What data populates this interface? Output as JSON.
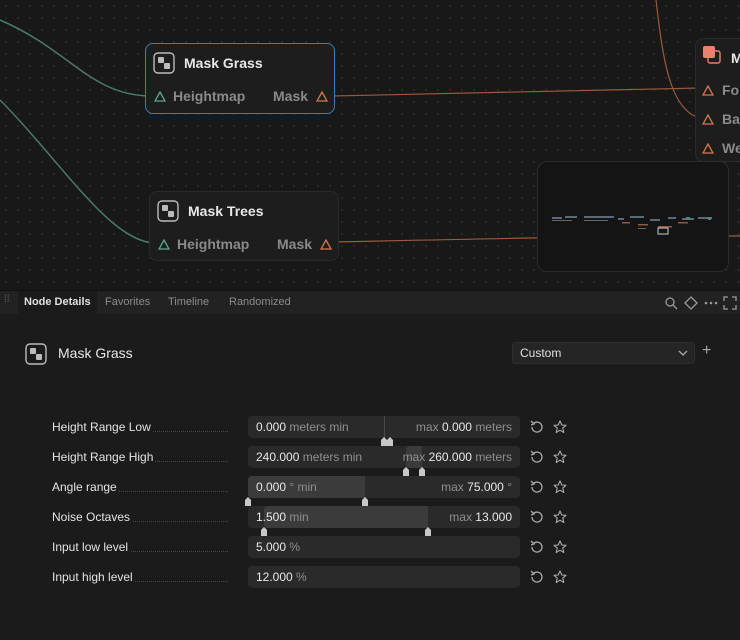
{
  "graph": {
    "nodes": [
      {
        "title": "Mask Grass",
        "input_label": "Heightmap",
        "output_label": "Mask",
        "selected": true
      },
      {
        "title": "Mask Trees",
        "input_label": "Heightmap",
        "output_label": "Mask",
        "selected": false
      },
      {
        "title": "M",
        "ports": [
          "For",
          "Ba",
          "We"
        ]
      }
    ],
    "colors": {
      "heightmap_wire": "#4a7a6c",
      "mask_wire": "#9a5a3c",
      "selection": "#3a7fb8",
      "accent_node": "#e8826a"
    }
  },
  "tabs": [
    {
      "label": "Node Details",
      "active": true
    },
    {
      "label": "Favorites",
      "active": false
    },
    {
      "label": "Timeline",
      "active": false
    },
    {
      "label": "Randomized",
      "active": false
    }
  ],
  "toolbar_icons": [
    "search-icon",
    "diamond-icon",
    "more-icon",
    "expand-icon"
  ],
  "details": {
    "title": "Mask Grass",
    "preset": "Custom",
    "add_label": "+",
    "params": [
      {
        "label": "Height Range Low",
        "left_value": "0.000",
        "left_unit": "meters min",
        "right_prefix": "max",
        "right_value": "0.000",
        "right_unit": "meters",
        "range": [
          0.5,
          0.5
        ]
      },
      {
        "label": "Height Range High",
        "left_value": "240.000",
        "left_unit": "meters min",
        "right_prefix": "max",
        "right_value": "260.000",
        "right_unit": "meters",
        "range": [
          0.58,
          0.64
        ]
      },
      {
        "label": "Angle range",
        "left_value": "0.000",
        "left_unit": "° min",
        "right_prefix": "max",
        "right_value": "75.000",
        "right_unit": "°",
        "range": [
          0.0,
          0.43
        ]
      },
      {
        "label": "Noise Octaves",
        "left_value": "1.500",
        "left_unit": "min",
        "right_prefix": "max",
        "right_value": "13.000",
        "right_unit": "",
        "range": [
          0.06,
          0.66
        ]
      },
      {
        "label": "Input low level",
        "left_value": "5.000",
        "left_unit": "%"
      },
      {
        "label": "Input high level",
        "left_value": "12.000",
        "left_unit": "%"
      }
    ]
  }
}
